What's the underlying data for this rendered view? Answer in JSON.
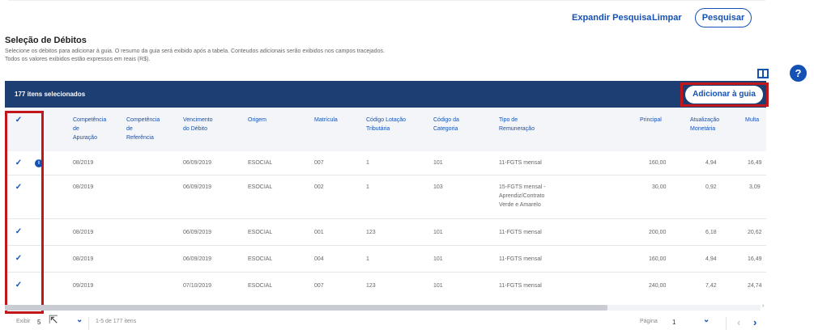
{
  "top_actions": {
    "expand": "Expandir Pesquisa",
    "clear": "Limpar",
    "search": "Pesquisar"
  },
  "section": {
    "title": "Seleção de Débitos",
    "desc1": "Selecione os débitos para adicionar à guia. O resumo da guia será exibido após a tabela. Conteudos adicionais serão exibidos nos campos tracejados.",
    "desc2": "Todos os valores exibidos estão expressos em reais (R$)."
  },
  "toolbar": {
    "help": "?",
    "selected_count": "177 itens selecionados",
    "add_button": "Adicionar à guia"
  },
  "columns": [
    "Competência de Apuração",
    "Competência de Referência",
    "Vencimento do Débito",
    "Origem",
    "Matrícula",
    "Código Lotação Tributária",
    "Código da Categoria",
    "Tipo de Remuneração",
    "Principal",
    "Atualização Monetária",
    "Multa"
  ],
  "column_lines": {
    "apuracao": [
      "Competência",
      "de",
      "Apuração"
    ],
    "referencia": [
      "Competência",
      "de",
      "Referência"
    ],
    "vencimento": [
      "Vencimento",
      "do Débito"
    ],
    "origem": [
      "Origem"
    ],
    "matricula": [
      "Matrícula"
    ],
    "lotacao": [
      "Código Lotação",
      "Tributária"
    ],
    "categoria": [
      "Código da",
      "Categoria"
    ],
    "remuneracao": [
      "Tipo de",
      "Remuneração"
    ],
    "principal": [
      "Principal"
    ],
    "atualizacao": [
      "Atualização",
      "Monetária"
    ],
    "multa": [
      "Multa"
    ]
  },
  "rows": [
    {
      "apuracao": "08/2019",
      "referencia": "",
      "vencimento": "06/09/2019",
      "origem": "ESOCIAL",
      "matricula": "007",
      "lotacao": "1",
      "categoria": "101",
      "remuneracao": [
        "11-FGTS mensal"
      ],
      "principal": "160,00",
      "atualizacao": "4,94",
      "multa": "16,49",
      "info": true
    },
    {
      "apuracao": "08/2019",
      "referencia": "",
      "vencimento": "06/09/2019",
      "origem": "ESOCIAL",
      "matricula": "002",
      "lotacao": "1",
      "categoria": "103",
      "remuneracao": [
        "15-FGTS mensal -",
        "Aprendiz/Contrato",
        "Verde e Amarelo"
      ],
      "principal": "30,00",
      "atualizacao": "0,92",
      "multa": "3,09",
      "info": false
    },
    {
      "apuracao": "08/2019",
      "referencia": "",
      "vencimento": "06/09/2019",
      "origem": "ESOCIAL",
      "matricula": "001",
      "lotacao": "123",
      "categoria": "101",
      "remuneracao": [
        "11-FGTS mensal"
      ],
      "principal": "200,00",
      "atualizacao": "6,18",
      "multa": "20,62",
      "info": false
    },
    {
      "apuracao": "08/2019",
      "referencia": "",
      "vencimento": "06/09/2019",
      "origem": "ESOCIAL",
      "matricula": "004",
      "lotacao": "1",
      "categoria": "101",
      "remuneracao": [
        "11-FGTS mensal"
      ],
      "principal": "160,00",
      "atualizacao": "4,94",
      "multa": "16,49",
      "info": false
    },
    {
      "apuracao": "09/2019",
      "referencia": "",
      "vencimento": "07/10/2019",
      "origem": "ESOCIAL",
      "matricula": "007",
      "lotacao": "123",
      "categoria": "101",
      "remuneracao": [
        "11-FGTS mensal"
      ],
      "principal": "240,00",
      "atualizacao": "7,42",
      "multa": "24,74",
      "info": false
    }
  ],
  "footer": {
    "show_label": "Exibir",
    "page_size": "5",
    "range": "1-5 de 177 itens",
    "page_label": "Página",
    "page_number": "1"
  },
  "icons": {
    "check": "✓",
    "chevron_down": "⌄",
    "chevron_left": "‹",
    "chevron_right": "›",
    "info": "i",
    "scroll_right": "›"
  },
  "colors": {
    "primary": "#1351b4",
    "header_bar": "#1d3e72",
    "highlight": "#c1161c"
  }
}
